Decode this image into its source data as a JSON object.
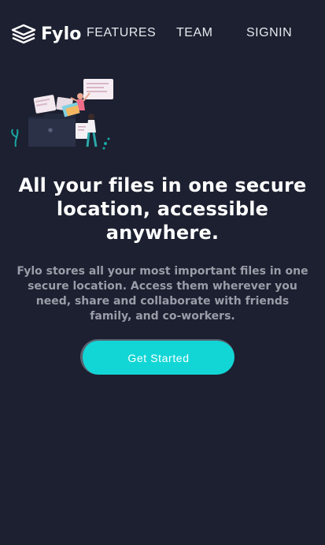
{
  "nav": {
    "logo_text": "Fylo",
    "logo_icon": "stacked-layers-icon",
    "links": {
      "features": "FEATURES",
      "team": "TEAM",
      "signin": "SIGNIN"
    }
  },
  "hero": {
    "illustration_icon": "files-illustration",
    "headline": "All your files in one secure location, accessible anywhere.",
    "subtext": "Fylo stores all your most important files in one secure location. Access them wherever you need, share and collaborate with friends family, and co-workers.",
    "cta_label": "Get Started"
  },
  "colors": {
    "background": "#1c2030",
    "accent": "#12d6d6",
    "text": "#ffffff",
    "muted": "#9a9ca8"
  }
}
